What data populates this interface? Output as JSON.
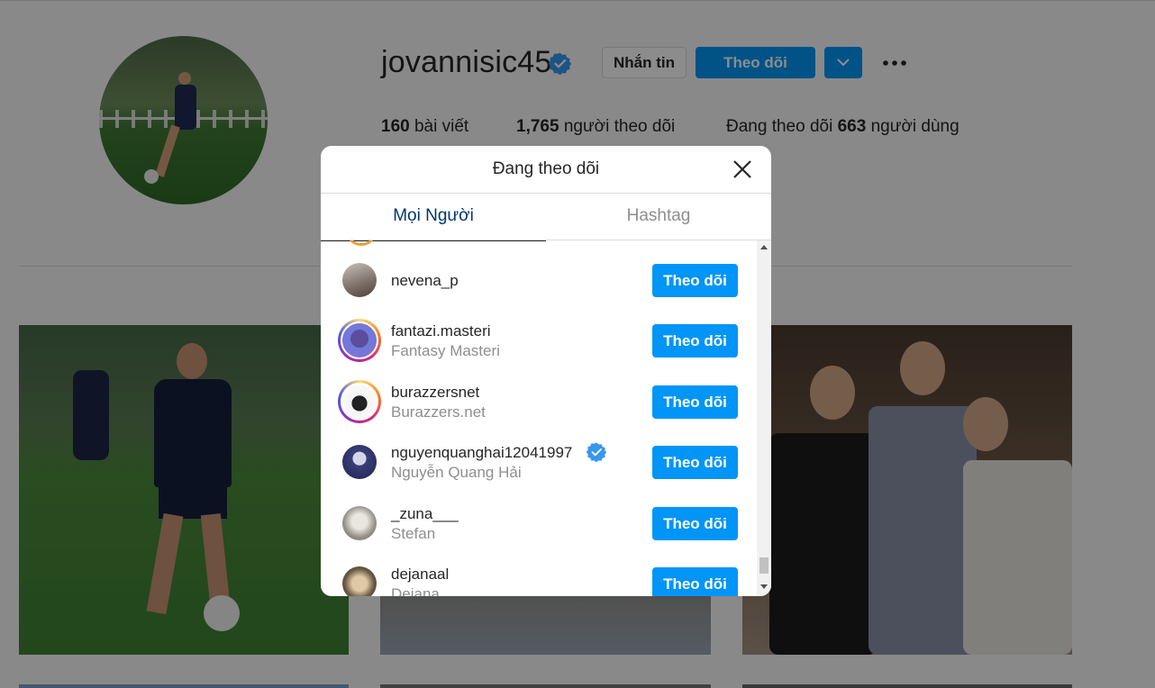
{
  "profile": {
    "username": "jovannisic45",
    "message_label": "Nhắn tin",
    "follow_label": "Theo dõi",
    "stats": {
      "posts_count": "160",
      "posts_label": "bài viết",
      "followers_count": "1,765",
      "followers_label": "người theo dõi",
      "following_prefix": "Đang theo dõi",
      "following_count": "663",
      "following_suffix": "người dùng"
    }
  },
  "modal": {
    "title": "Đang theo dõi",
    "tabs": [
      "Mọi Người",
      "Hashtag"
    ],
    "follow_label": "Theo dõi",
    "rows": [
      {
        "username": "nevena_p",
        "fullname": "",
        "verified": false,
        "story_ring": false
      },
      {
        "username": "fantazi.masteri",
        "fullname": "Fantasy Masteri",
        "verified": false,
        "story_ring": true
      },
      {
        "username": "burazzersnet",
        "fullname": "Burazzers.net",
        "verified": false,
        "story_ring": true
      },
      {
        "username": "nguyenquanghai12041997",
        "fullname": "Nguyễn Quang Hải",
        "verified": true,
        "story_ring": false
      },
      {
        "username": "_zuna___",
        "fullname": "Stefan",
        "verified": false,
        "story_ring": false
      },
      {
        "username": "dejanaal",
        "fullname": "Dejana",
        "verified": false,
        "story_ring": false
      }
    ]
  },
  "colors": {
    "accent": "#0095f6",
    "verified": "#3897f0",
    "active_tab": "#00376b"
  },
  "icons": [
    "verified-icon",
    "chevron-down-icon",
    "more-icon",
    "close-icon",
    "scroll-up-arrow-icon",
    "scroll-down-arrow-icon"
  ]
}
